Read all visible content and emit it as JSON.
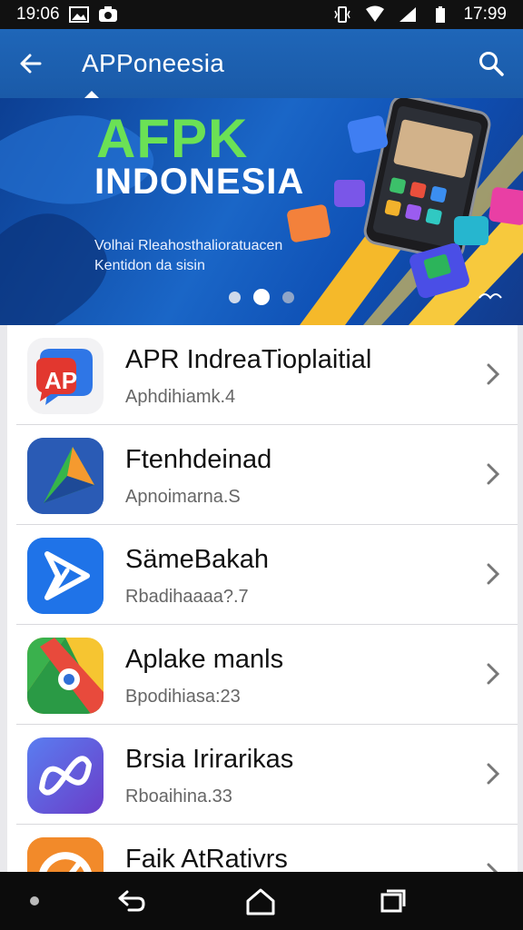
{
  "status_bar": {
    "time_left": "19:06",
    "time_right": "17:99"
  },
  "app_bar": {
    "title": "APPoneesia"
  },
  "banner": {
    "title_line1": "AFPK",
    "title_line2": "INDONESIA",
    "subtitle": "Volhai Rleahosthalioratuacen Kentidon da sisin",
    "slides": 3,
    "active_slide": 1
  },
  "apps": [
    {
      "name": "APR IndreaTioplaitial",
      "meta": "Aphdihiamk.4",
      "icon": "ap-logo-icon"
    },
    {
      "name": "Ftenhdeinad",
      "meta": "Apnoimarna.S",
      "icon": "triangle-play-icon"
    },
    {
      "name": "SämeBakah",
      "meta": "Rbadihaaaa?.7",
      "icon": "arrow-play-icon"
    },
    {
      "name": "Aplake manls",
      "meta": "Bpodihiasa:23",
      "icon": "colorful-eye-icon"
    },
    {
      "name": "Brsia Irirarikas",
      "meta": "Rboaihina.33",
      "icon": "infinity-icon"
    },
    {
      "name": "Faik AtRativrs",
      "meta": "",
      "icon": "orange-gauge-icon"
    }
  ]
}
